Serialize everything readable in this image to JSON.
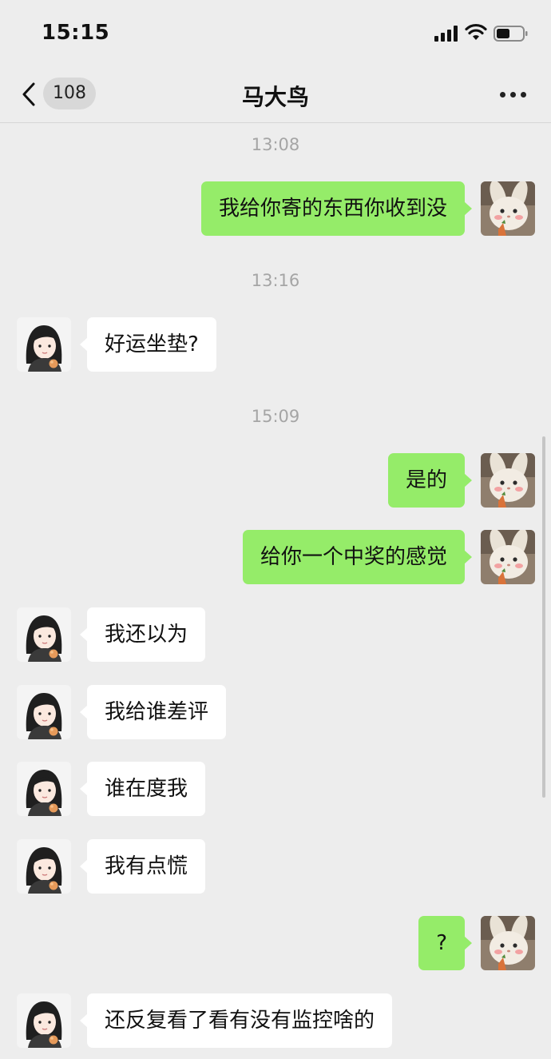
{
  "status_bar": {
    "time": "15:15",
    "battery_level": 0.5
  },
  "nav": {
    "unread_count": "108",
    "title": "马大鸟"
  },
  "icons": {
    "back": "chevron-left-icon",
    "more": "more-dots-icon",
    "signal": "cellular-signal-icon",
    "wifi": "wifi-icon",
    "battery": "battery-icon"
  },
  "colors": {
    "background": "#ededed",
    "incoming_bubble": "#ffffff",
    "outgoing_bubble": "#95ec69"
  },
  "messages": {
    "ts1": "13:08",
    "m1": "我给你寄的东西你收到没",
    "ts2": "13:16",
    "m2": "好运坐垫?",
    "ts3": "15:09",
    "m3": "是的",
    "m4": "给你一个中奖的感觉",
    "m5": "我还以为",
    "m6": "我给谁差评",
    "m7": "谁在度我",
    "m8": "我有点慌",
    "m9": "?",
    "m10": "还反复看了看有没有监控啥的"
  }
}
